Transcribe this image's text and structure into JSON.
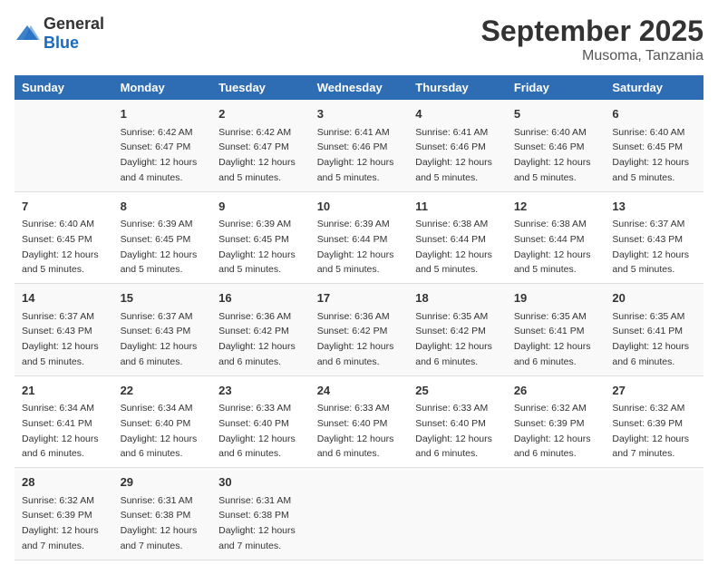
{
  "logo": {
    "general": "General",
    "blue": "Blue"
  },
  "title": "September 2025",
  "subtitle": "Musoma, Tanzania",
  "weekdays": [
    "Sunday",
    "Monday",
    "Tuesday",
    "Wednesday",
    "Thursday",
    "Friday",
    "Saturday"
  ],
  "weeks": [
    [
      {
        "day": "",
        "sunrise": "",
        "sunset": "",
        "daylight": ""
      },
      {
        "day": "1",
        "sunrise": "Sunrise: 6:42 AM",
        "sunset": "Sunset: 6:47 PM",
        "daylight": "Daylight: 12 hours and 4 minutes."
      },
      {
        "day": "2",
        "sunrise": "Sunrise: 6:42 AM",
        "sunset": "Sunset: 6:47 PM",
        "daylight": "Daylight: 12 hours and 5 minutes."
      },
      {
        "day": "3",
        "sunrise": "Sunrise: 6:41 AM",
        "sunset": "Sunset: 6:46 PM",
        "daylight": "Daylight: 12 hours and 5 minutes."
      },
      {
        "day": "4",
        "sunrise": "Sunrise: 6:41 AM",
        "sunset": "Sunset: 6:46 PM",
        "daylight": "Daylight: 12 hours and 5 minutes."
      },
      {
        "day": "5",
        "sunrise": "Sunrise: 6:40 AM",
        "sunset": "Sunset: 6:46 PM",
        "daylight": "Daylight: 12 hours and 5 minutes."
      },
      {
        "day": "6",
        "sunrise": "Sunrise: 6:40 AM",
        "sunset": "Sunset: 6:45 PM",
        "daylight": "Daylight: 12 hours and 5 minutes."
      }
    ],
    [
      {
        "day": "7",
        "sunrise": "Sunrise: 6:40 AM",
        "sunset": "Sunset: 6:45 PM",
        "daylight": "Daylight: 12 hours and 5 minutes."
      },
      {
        "day": "8",
        "sunrise": "Sunrise: 6:39 AM",
        "sunset": "Sunset: 6:45 PM",
        "daylight": "Daylight: 12 hours and 5 minutes."
      },
      {
        "day": "9",
        "sunrise": "Sunrise: 6:39 AM",
        "sunset": "Sunset: 6:45 PM",
        "daylight": "Daylight: 12 hours and 5 minutes."
      },
      {
        "day": "10",
        "sunrise": "Sunrise: 6:39 AM",
        "sunset": "Sunset: 6:44 PM",
        "daylight": "Daylight: 12 hours and 5 minutes."
      },
      {
        "day": "11",
        "sunrise": "Sunrise: 6:38 AM",
        "sunset": "Sunset: 6:44 PM",
        "daylight": "Daylight: 12 hours and 5 minutes."
      },
      {
        "day": "12",
        "sunrise": "Sunrise: 6:38 AM",
        "sunset": "Sunset: 6:44 PM",
        "daylight": "Daylight: 12 hours and 5 minutes."
      },
      {
        "day": "13",
        "sunrise": "Sunrise: 6:37 AM",
        "sunset": "Sunset: 6:43 PM",
        "daylight": "Daylight: 12 hours and 5 minutes."
      }
    ],
    [
      {
        "day": "14",
        "sunrise": "Sunrise: 6:37 AM",
        "sunset": "Sunset: 6:43 PM",
        "daylight": "Daylight: 12 hours and 5 minutes."
      },
      {
        "day": "15",
        "sunrise": "Sunrise: 6:37 AM",
        "sunset": "Sunset: 6:43 PM",
        "daylight": "Daylight: 12 hours and 6 minutes."
      },
      {
        "day": "16",
        "sunrise": "Sunrise: 6:36 AM",
        "sunset": "Sunset: 6:42 PM",
        "daylight": "Daylight: 12 hours and 6 minutes."
      },
      {
        "day": "17",
        "sunrise": "Sunrise: 6:36 AM",
        "sunset": "Sunset: 6:42 PM",
        "daylight": "Daylight: 12 hours and 6 minutes."
      },
      {
        "day": "18",
        "sunrise": "Sunrise: 6:35 AM",
        "sunset": "Sunset: 6:42 PM",
        "daylight": "Daylight: 12 hours and 6 minutes."
      },
      {
        "day": "19",
        "sunrise": "Sunrise: 6:35 AM",
        "sunset": "Sunset: 6:41 PM",
        "daylight": "Daylight: 12 hours and 6 minutes."
      },
      {
        "day": "20",
        "sunrise": "Sunrise: 6:35 AM",
        "sunset": "Sunset: 6:41 PM",
        "daylight": "Daylight: 12 hours and 6 minutes."
      }
    ],
    [
      {
        "day": "21",
        "sunrise": "Sunrise: 6:34 AM",
        "sunset": "Sunset: 6:41 PM",
        "daylight": "Daylight: 12 hours and 6 minutes."
      },
      {
        "day": "22",
        "sunrise": "Sunrise: 6:34 AM",
        "sunset": "Sunset: 6:40 PM",
        "daylight": "Daylight: 12 hours and 6 minutes."
      },
      {
        "day": "23",
        "sunrise": "Sunrise: 6:33 AM",
        "sunset": "Sunset: 6:40 PM",
        "daylight": "Daylight: 12 hours and 6 minutes."
      },
      {
        "day": "24",
        "sunrise": "Sunrise: 6:33 AM",
        "sunset": "Sunset: 6:40 PM",
        "daylight": "Daylight: 12 hours and 6 minutes."
      },
      {
        "day": "25",
        "sunrise": "Sunrise: 6:33 AM",
        "sunset": "Sunset: 6:40 PM",
        "daylight": "Daylight: 12 hours and 6 minutes."
      },
      {
        "day": "26",
        "sunrise": "Sunrise: 6:32 AM",
        "sunset": "Sunset: 6:39 PM",
        "daylight": "Daylight: 12 hours and 6 minutes."
      },
      {
        "day": "27",
        "sunrise": "Sunrise: 6:32 AM",
        "sunset": "Sunset: 6:39 PM",
        "daylight": "Daylight: 12 hours and 7 minutes."
      }
    ],
    [
      {
        "day": "28",
        "sunrise": "Sunrise: 6:32 AM",
        "sunset": "Sunset: 6:39 PM",
        "daylight": "Daylight: 12 hours and 7 minutes."
      },
      {
        "day": "29",
        "sunrise": "Sunrise: 6:31 AM",
        "sunset": "Sunset: 6:38 PM",
        "daylight": "Daylight: 12 hours and 7 minutes."
      },
      {
        "day": "30",
        "sunrise": "Sunrise: 6:31 AM",
        "sunset": "Sunset: 6:38 PM",
        "daylight": "Daylight: 12 hours and 7 minutes."
      },
      {
        "day": "",
        "sunrise": "",
        "sunset": "",
        "daylight": ""
      },
      {
        "day": "",
        "sunrise": "",
        "sunset": "",
        "daylight": ""
      },
      {
        "day": "",
        "sunrise": "",
        "sunset": "",
        "daylight": ""
      },
      {
        "day": "",
        "sunrise": "",
        "sunset": "",
        "daylight": ""
      }
    ]
  ]
}
